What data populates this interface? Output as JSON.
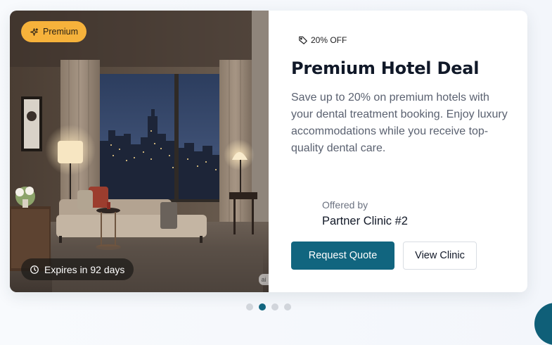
{
  "offer": {
    "badge": {
      "label": "Premium",
      "icon": "sparkles-icon",
      "color": "#f6b23b"
    },
    "expires": {
      "label": "Expires in 92 days",
      "icon": "clock-icon"
    },
    "image_watermark": "ai",
    "discount": {
      "label": "20% OFF",
      "icon": "tag-icon"
    },
    "title": "Premium Hotel Deal",
    "description": "Save up to 20% on premium hotels with your dental treatment booking. Enjoy luxury accommodations while you receive top-quality dental care.",
    "offered_by_label": "Offered by",
    "provider": "Partner Clinic #2",
    "primary_button": "Request Quote",
    "secondary_button": "View Clinic"
  },
  "carousel": {
    "total": 4,
    "active_index": 1
  },
  "colors": {
    "accent": "#11657f",
    "badge": "#f6b23b"
  }
}
